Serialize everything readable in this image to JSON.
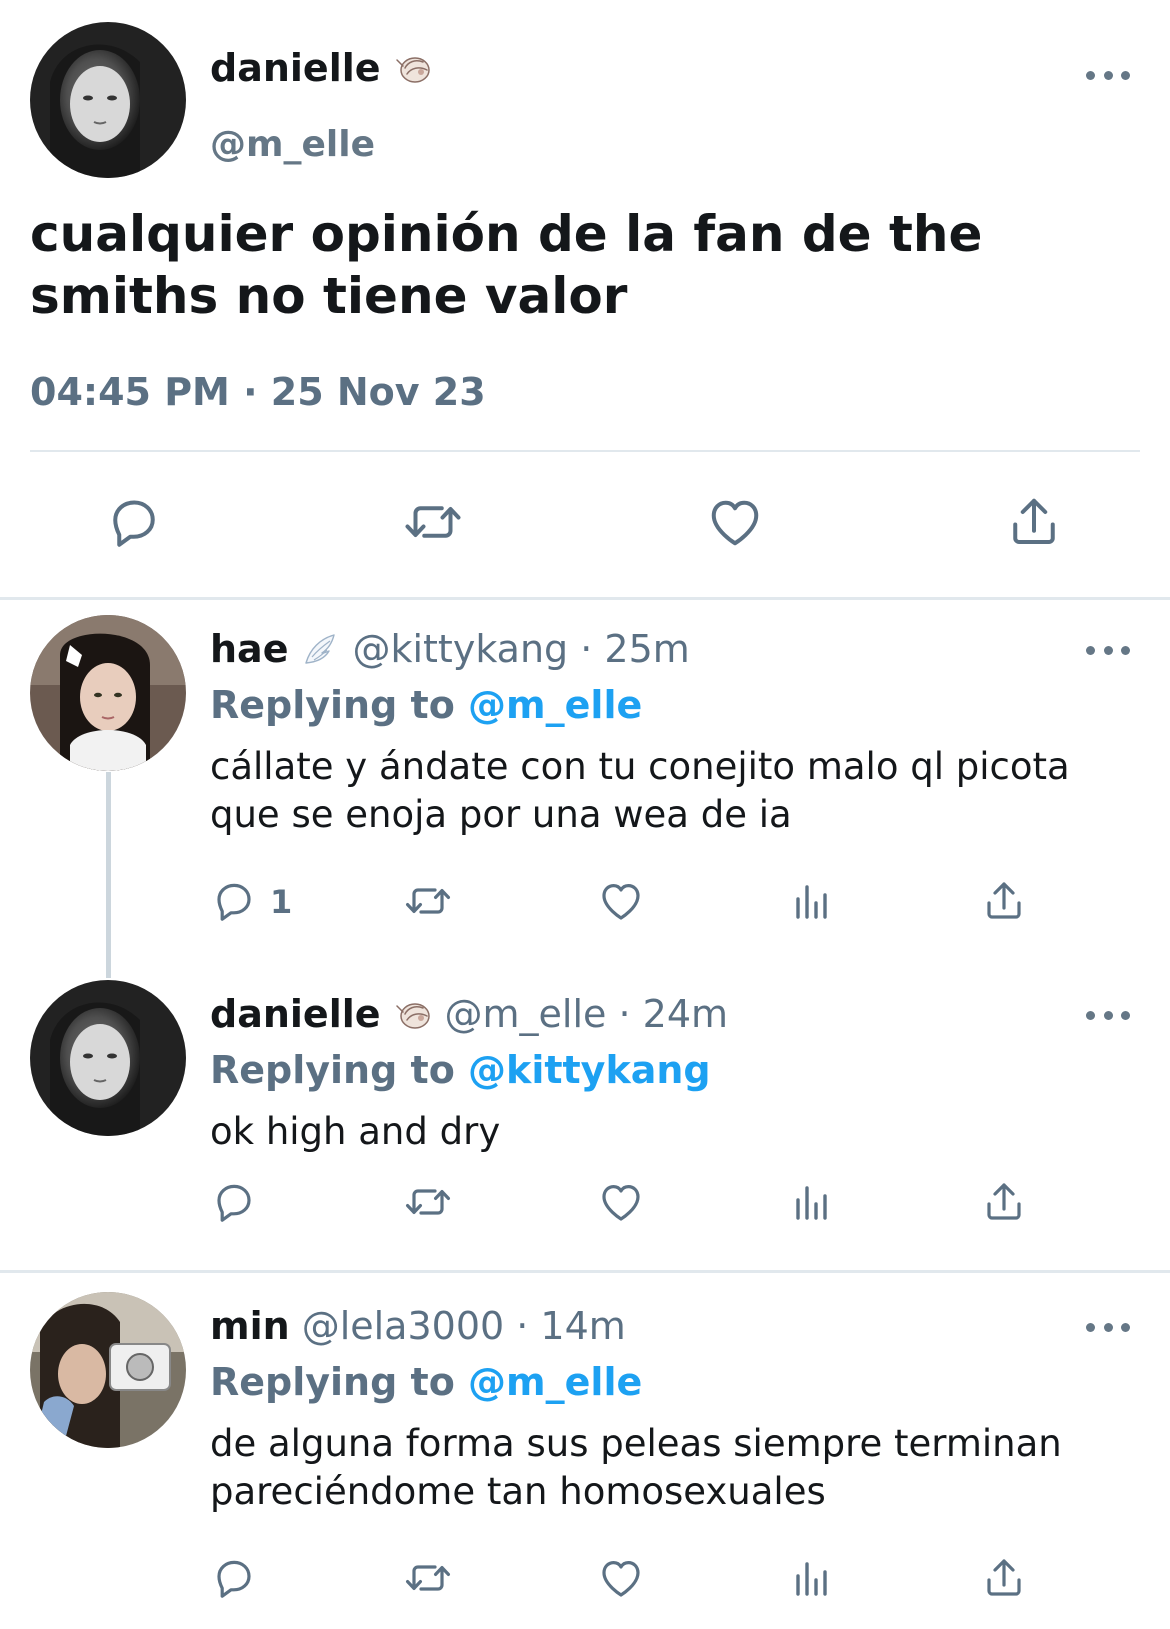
{
  "main_tweet": {
    "name": "danielle",
    "name_emoji": "spiral-shell-emoji",
    "handle": "@m_elle",
    "text": "cualquier opinión de la fan de the smiths no tiene valor",
    "timestamp": "04:45 PM · 25 Nov 23",
    "actions": [
      "reply-icon",
      "retweet-icon",
      "like-icon",
      "share-icon"
    ]
  },
  "replies": [
    {
      "name": "hae",
      "name_emoji": "wing-emoji",
      "handle": "@kittykang · 25m",
      "replying_prefix": "Replying to",
      "replying_to": "@m_elle",
      "text": "cállate y ándate con tu conejito malo ql picota que se enoja por una wea de ia",
      "reply_count": "1"
    },
    {
      "name": "danielle",
      "name_emoji": "spiral-shell-emoji",
      "handle": "@m_elle · 24m",
      "replying_prefix": "Replying to",
      "replying_to": "@kittykang",
      "text": "ok high and dry",
      "reply_count": ""
    },
    {
      "name": "min",
      "name_emoji": "",
      "handle": "@lela3000 · 14m",
      "replying_prefix": "Replying to",
      "replying_to": "@m_elle",
      "text": "de alguna forma sus peleas siempre terminan pareciéndome tan homosexuales",
      "reply_count": ""
    }
  ],
  "colors": {
    "text": "#14171a",
    "secondary": "#5b7083",
    "accent": "#1da1f2",
    "divider": "#e1e8ed"
  }
}
